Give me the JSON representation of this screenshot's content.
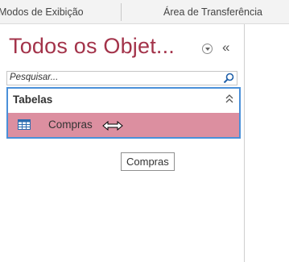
{
  "ribbon": {
    "groups": [
      {
        "label": "Modos de Exibição"
      },
      {
        "label": "Área de Transferência"
      }
    ]
  },
  "nav_pane": {
    "title": "Todos os Objet...",
    "menu_icon": "circle-chevron-down-icon",
    "collapse_label": "«",
    "search": {
      "placeholder": "Pesquisar...",
      "icon": "search-icon"
    },
    "group": {
      "label": "Tabelas",
      "toggle_icon": "double-chevron-up-icon",
      "items": [
        {
          "label": "Compras",
          "icon": "table-icon",
          "state": "selected"
        }
      ]
    }
  },
  "tooltip": {
    "text": "Compras"
  },
  "colors": {
    "title": "#a3334a",
    "selection": "#dc8fa0",
    "focus_border": "#4a90d9"
  }
}
